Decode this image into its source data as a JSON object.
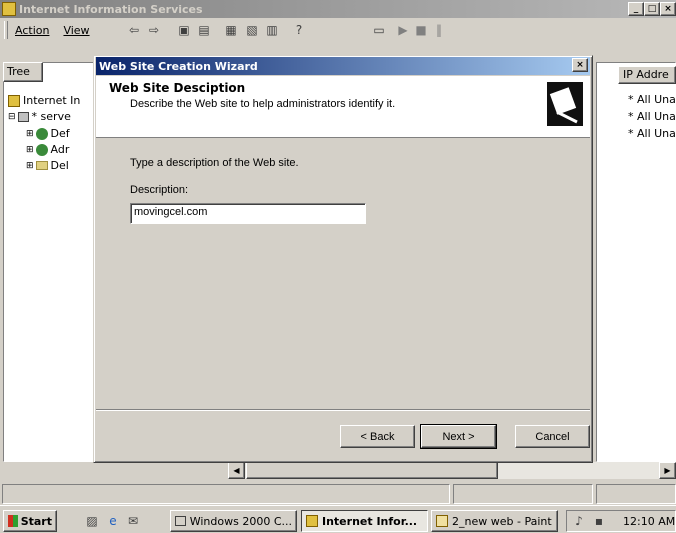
{
  "main_window": {
    "title": "Internet Information Services",
    "controls": {
      "minimize": "_",
      "maximize": "□",
      "close": "×"
    },
    "menu": [
      "Action",
      "View"
    ],
    "toolbar_icons": [
      "back-icon",
      "forward-icon",
      "up-icon",
      "show-hide-icon",
      "export-icon",
      "properties-icon",
      "refresh-icon",
      "help-icon",
      "computer-icon",
      "play-icon",
      "stop-icon",
      "pause-icon"
    ]
  },
  "tree": {
    "tab_label": "Tree",
    "items": [
      {
        "label": "Internet In",
        "icon": "iis-icon"
      },
      {
        "label": "* serve",
        "icon": "server-icon"
      },
      {
        "label": "Def",
        "icon": "globe-icon"
      },
      {
        "label": "Adr",
        "icon": "globe-icon"
      },
      {
        "label": "Del",
        "icon": "folder-icon"
      }
    ]
  },
  "list": {
    "column_header": "IP Addre",
    "rows": [
      "* All Una",
      "* All Una",
      "* All Una"
    ]
  },
  "wizard": {
    "title": "Web Site Creation Wizard",
    "close": "×",
    "header_title": "Web Site Desciption",
    "header_subtitle": "Describe the Web site to help administrators identify it.",
    "instruction": "Type a description of the Web site.",
    "description_label": "Description:",
    "description_value": "movingcel.com",
    "buttons": {
      "back": "< Back",
      "next": "Next >",
      "cancel": "Cancel"
    }
  },
  "taskbar": {
    "start_label": "Start",
    "tasks": [
      {
        "label": "Windows 2000 C...",
        "active": false
      },
      {
        "label": "Internet Infor...",
        "active": true
      },
      {
        "label": "2_new web - Paint",
        "active": false
      }
    ],
    "clock": "12:10 AM"
  }
}
